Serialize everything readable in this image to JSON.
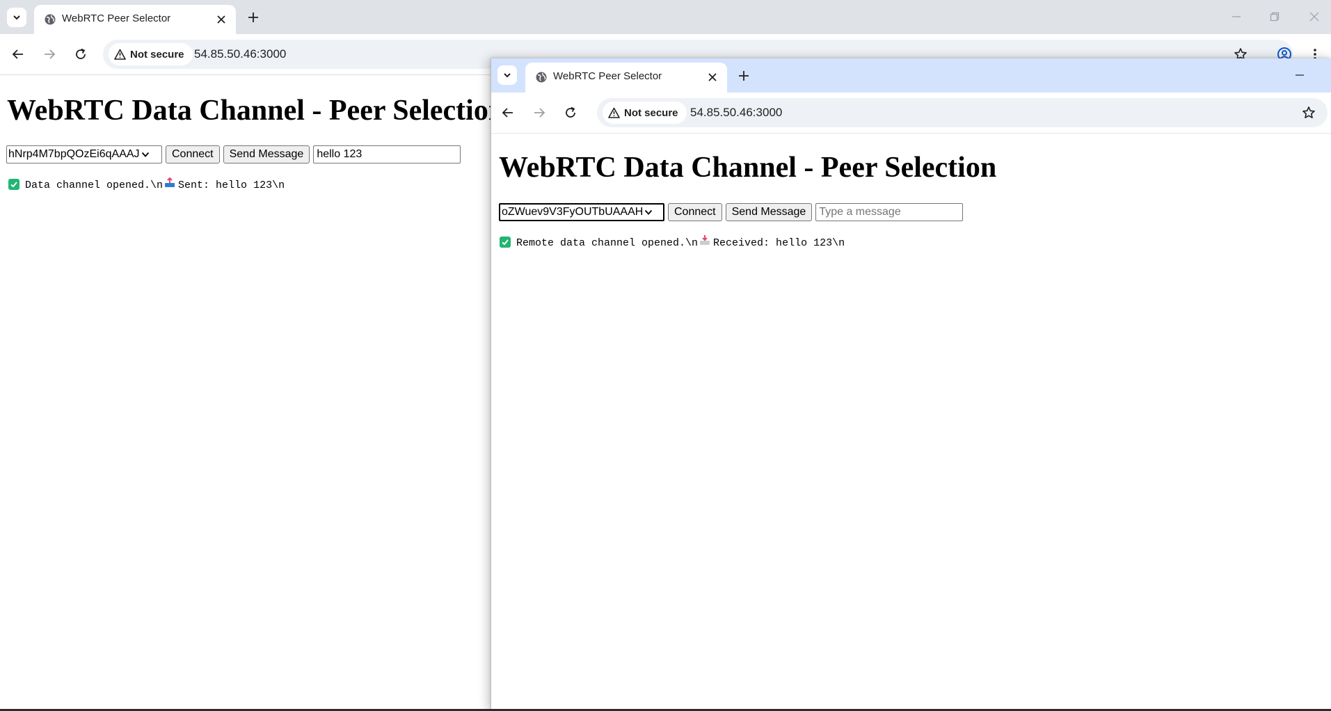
{
  "window_left": {
    "tab_title": "WebRTC Peer Selector",
    "security_chip": "Not secure",
    "url": "54.85.50.46:3000",
    "page": {
      "heading": "WebRTC Data Channel - Peer Selection",
      "peer_select_value": "hNrp4M7bpQOzEi6qAAAJ",
      "connect_label": "Connect",
      "send_label": "Send Message",
      "message_value": "hello 123",
      "message_placeholder": "Type a message",
      "log_part1": "Data channel opened.\\n",
      "log_part2": "Sent: hello 123\\n"
    }
  },
  "window_right": {
    "tab_title": "WebRTC Peer Selector",
    "security_chip": "Not secure",
    "url": "54.85.50.46:3000",
    "page": {
      "heading": "WebRTC Data Channel - Peer Selection",
      "peer_select_value": "oZWuev9V3FyOUTbUAAAH",
      "connect_label": "Connect",
      "send_label": "Send Message",
      "message_value": "",
      "message_placeholder": "Type a message",
      "log_part1": "Remote data channel opened.\\n",
      "log_part2": "Received: hello 123\\n"
    }
  },
  "colors": {
    "active_tabstrip": "#d3e3fd",
    "inactive_tabstrip": "#dfe3e8",
    "omnibox": "#eef1f5",
    "log_check": "#22b573",
    "outbox_tray": "#2f7dd1",
    "inbox_tray": "#e7456a"
  }
}
